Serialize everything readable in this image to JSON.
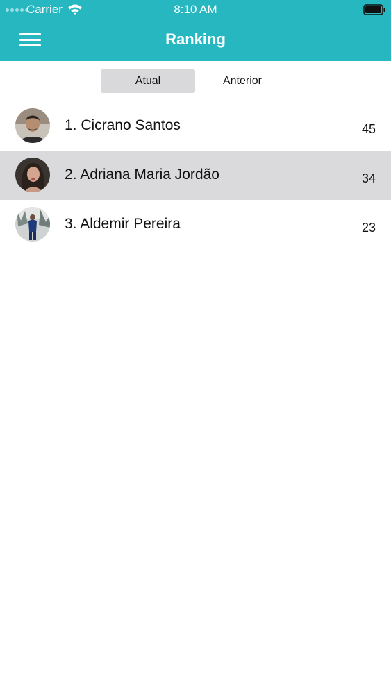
{
  "status_bar": {
    "carrier": "Carrier",
    "time": "8:10 AM"
  },
  "header": {
    "title": "Ranking"
  },
  "tabs": [
    {
      "label": "Atual",
      "selected": true
    },
    {
      "label": "Anterior",
      "selected": false
    }
  ],
  "ranking": [
    {
      "label": "1. Cicrano Santos",
      "score": "45"
    },
    {
      "label": "2. Adriana Maria Jordão",
      "score": "34"
    },
    {
      "label": "3. Aldemir Pereira",
      "score": "23"
    }
  ],
  "colors": {
    "header": "#26b7c0",
    "selected_row": "#dad9dc",
    "selected_tab": "#d9d8db"
  },
  "icons": {
    "menu": "hamburger-icon",
    "wifi": "wifi-icon",
    "battery": "battery-icon"
  }
}
